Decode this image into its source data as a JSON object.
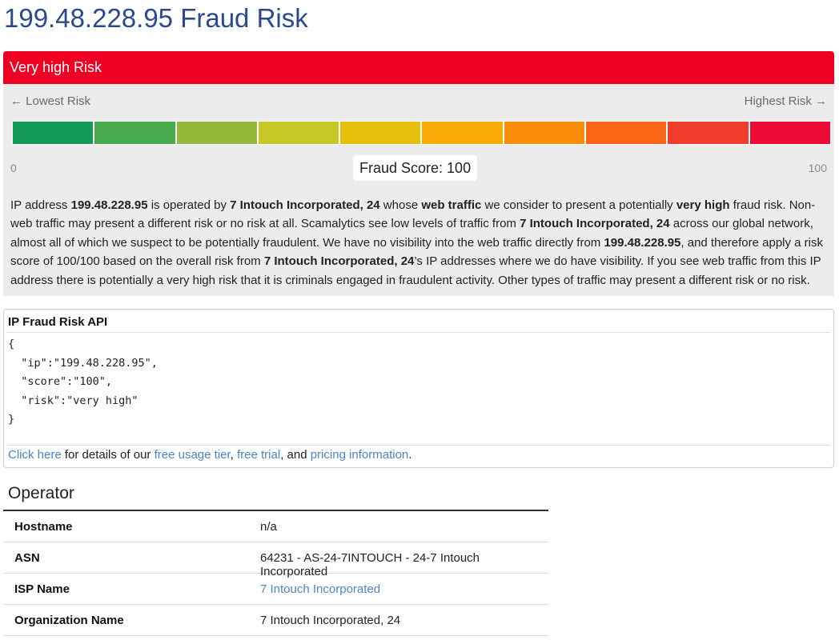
{
  "page": {
    "title": "199.48.228.95 Fraud Risk"
  },
  "risk": {
    "level_label": "Very high Risk",
    "lowest_label": "← Lowest Risk",
    "highest_label": "Highest Risk →",
    "scale_min": "0",
    "scale_max": "100",
    "score_text": "Fraud Score: 100",
    "score_value": 100,
    "header_color": "#ee0022",
    "scale_colors": [
      "#139a59",
      "#48aa4c",
      "#93b93a",
      "#c6c626",
      "#e6bf0c",
      "#f8ab05",
      "#fb8c07",
      "#fb6616",
      "#f03c2a",
      "#ee0a36"
    ]
  },
  "description": {
    "p1": "IP address ",
    "ip": "199.48.228.95",
    "p2": " is operated by ",
    "org": "7 Intouch Incorporated, 24",
    "p3": " whose ",
    "web_traffic": "web traffic",
    "p4": " we consider to present a potentially ",
    "very_high": "very high",
    "p5": " fraud risk. Non-web traffic may present a different risk or no risk at all. Scamalytics see low levels of traffic from ",
    "org2": "7 Intouch Incorporated, 24",
    "p6": " across our global network, almost all of which we suspect to be potentially fraudulent. We have no visibility into the web traffic directly from ",
    "ip2": "199.48.228.95",
    "p7": ", and therefore apply a risk score of 100/100 based on the overall risk from ",
    "org3": "7 Intouch Incorporated, 24",
    "p8": "’s IP addresses where we do have visibility. If you see web traffic from this IP address there is potentially a very high risk that it is criminals engaged in fraudulent activity. Other types of traffic may present a different risk or no risk."
  },
  "api": {
    "title": "IP Fraud Risk API",
    "json_text": "{\n  \"ip\":\"199.48.228.95\",\n  \"score\":\"100\",\n  \"risk\":\"very high\"\n}",
    "click_here": "Click here",
    "text1": " for details of our ",
    "free_usage": "free usage tier",
    "comma": ", ",
    "free_trial": "free trial",
    "text2": ", and ",
    "pricing": "pricing information",
    "period": "."
  },
  "operator": {
    "title": "Operator",
    "rows": [
      {
        "key": "Hostname",
        "value": "n/a"
      },
      {
        "key": "ASN",
        "value": "64231 - AS-24-7INTOUCH - 24-7 Intouch Incorporated"
      },
      {
        "key": "ISP Name",
        "value": "7 Intouch Incorporated"
      },
      {
        "key": "Organization Name",
        "value": "7 Intouch Incorporated, 24"
      }
    ]
  }
}
